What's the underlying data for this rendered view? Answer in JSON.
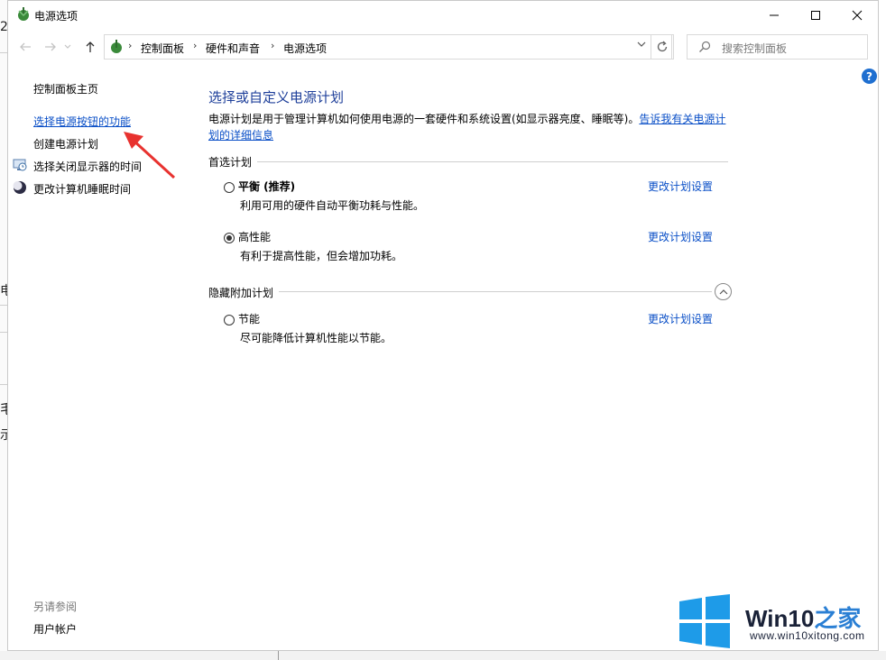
{
  "background_window": {
    "fragments": [
      "2",
      "电",
      "毛",
      "示"
    ]
  },
  "window": {
    "title": "电源选项",
    "controls": {
      "minimize": "—",
      "maximize": "☐",
      "close": "✕"
    }
  },
  "navbar": {
    "breadcrumbs": [
      "控制面板",
      "硬件和声音",
      "电源选项"
    ],
    "search_placeholder": "搜索控制面板",
    "help": "?"
  },
  "left_pane": {
    "home": "控制面板主页",
    "links": [
      {
        "label": "选择电源按钮的功能",
        "icon": null
      },
      {
        "label": "创建电源计划",
        "icon": null
      },
      {
        "label": "选择关闭显示器的时间",
        "icon": "monitor-clock-icon"
      },
      {
        "label": "更改计算机睡眠时间",
        "icon": "moon-icon"
      }
    ],
    "see_also_title": "另请参阅",
    "see_also_link": "用户帐户"
  },
  "main": {
    "title": "选择或自定义电源计划",
    "desc_text": "电源计划是用于管理计算机如何使用电源的一套硬件和系统设置(如显示器亮度、睡眠等)。",
    "desc_link": "告诉我有关电源计划的详细信息",
    "preferred_label": "首选计划",
    "hidden_label": "隐藏附加计划",
    "plans": [
      {
        "name": "平衡 (推荐)",
        "desc": "利用可用的硬件自动平衡功耗与性能。",
        "selected": false,
        "link": "更改计划设置"
      },
      {
        "name": "高性能",
        "desc": "有利于提高性能，但会增加功耗。",
        "selected": true,
        "link": "更改计划设置"
      },
      {
        "name": "节能",
        "desc": "尽可能降低计算机性能以节能。",
        "selected": false,
        "link": "更改计划设置"
      }
    ]
  },
  "watermark": {
    "brand": "Win10",
    "brand_suffix": "之家",
    "url": "www.win10xitong.com"
  },
  "colors": {
    "link": "#0a4fc7",
    "title": "#1e3f9a",
    "arrow": "#e8322f",
    "win_logo": "#1e9be8"
  }
}
